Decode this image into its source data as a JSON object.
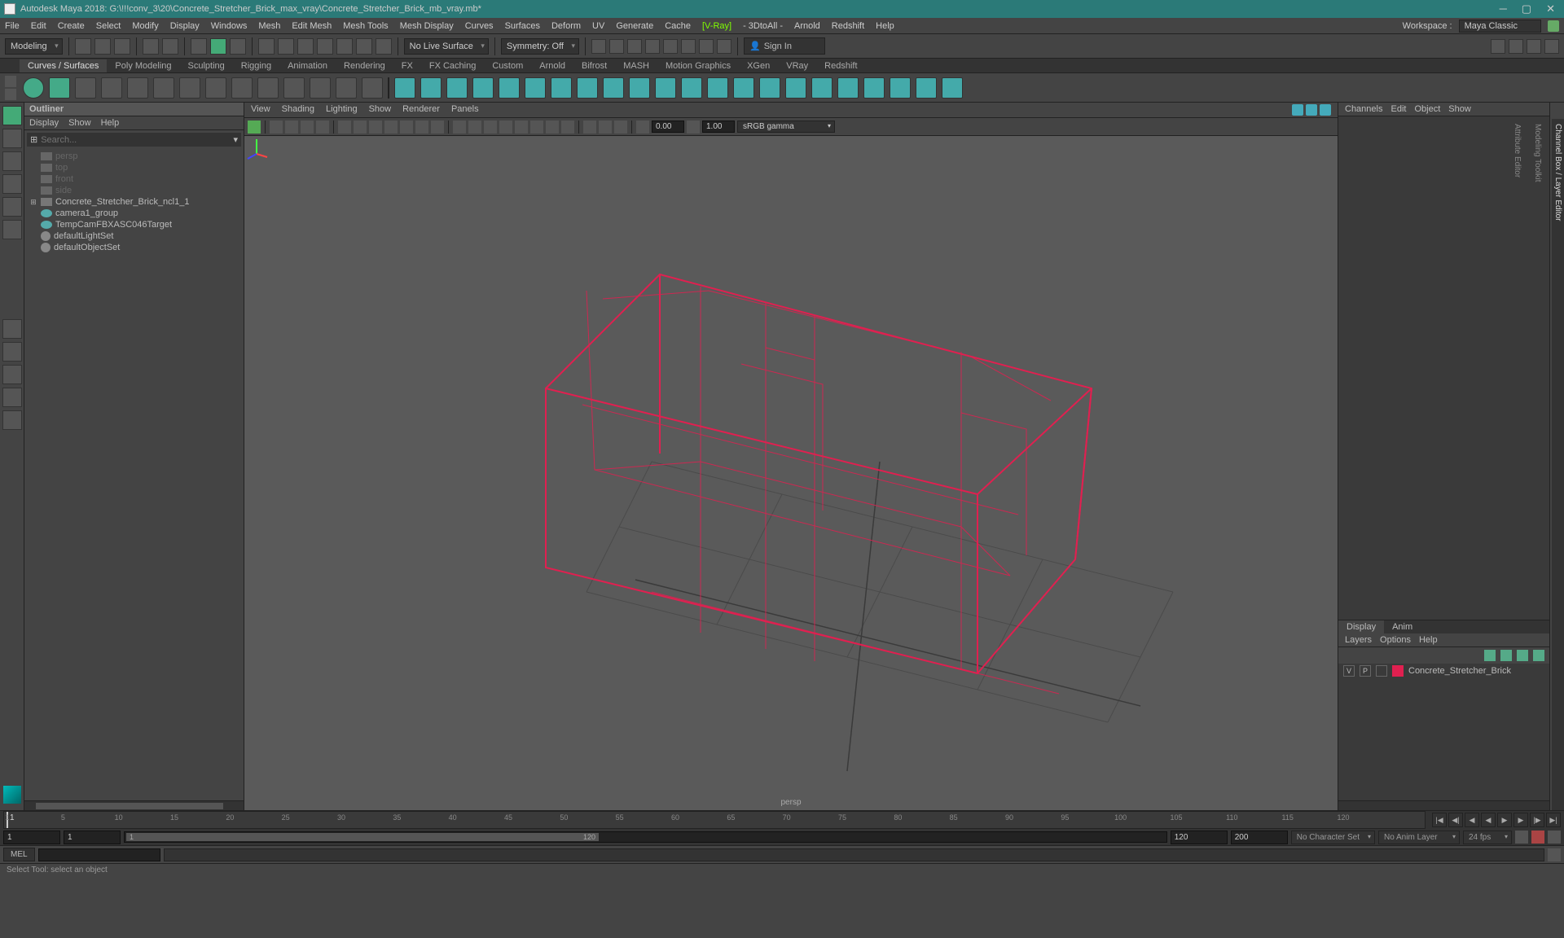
{
  "title": "Autodesk Maya 2018: G:\\!!!conv_3\\20\\Concrete_Stretcher_Brick_max_vray\\Concrete_Stretcher_Brick_mb_vray.mb*",
  "menubar": [
    "File",
    "Edit",
    "Create",
    "Select",
    "Modify",
    "Display",
    "Windows",
    "Mesh",
    "Edit Mesh",
    "Mesh Tools",
    "Mesh Display",
    "Curves",
    "Surfaces",
    "Deform",
    "UV",
    "Generate",
    "Cache"
  ],
  "menubar_vray": "[V-Ray]",
  "menubar2": [
    "- 3DtoAll -",
    "Arnold",
    "Redshift",
    "Help"
  ],
  "workspace_label": "Workspace :",
  "workspace_value": "Maya Classic",
  "modeling_dd": "Modeling",
  "no_live": "No Live Surface",
  "symmetry": "Symmetry: Off",
  "signin": "Sign In",
  "shelf_tabs": [
    "Curves / Surfaces",
    "Poly Modeling",
    "Sculpting",
    "Rigging",
    "Animation",
    "Rendering",
    "FX",
    "FX Caching",
    "Custom",
    "Arnold",
    "Bifrost",
    "MASH",
    "Motion Graphics",
    "XGen",
    "VRay",
    "Redshift"
  ],
  "outliner": {
    "title": "Outliner",
    "menu": [
      "Display",
      "Show",
      "Help"
    ],
    "search_placeholder": "Search...",
    "items": [
      {
        "label": "persp",
        "type": "cam",
        "dim": true
      },
      {
        "label": "top",
        "type": "cam",
        "dim": true
      },
      {
        "label": "front",
        "type": "cam",
        "dim": true
      },
      {
        "label": "side",
        "type": "cam",
        "dim": true
      },
      {
        "label": "Concrete_Stretcher_Brick_ncl1_1",
        "type": "mesh",
        "expand": true
      },
      {
        "label": "camera1_group",
        "type": "grp"
      },
      {
        "label": "TempCamFBXASC046Target",
        "type": "grp"
      },
      {
        "label": "defaultLightSet",
        "type": "set"
      },
      {
        "label": "defaultObjectSet",
        "type": "set"
      }
    ]
  },
  "viewport": {
    "menu": [
      "View",
      "Shading",
      "Lighting",
      "Show",
      "Renderer",
      "Panels"
    ],
    "num1": "0.00",
    "num2": "1.00",
    "gamma": "sRGB gamma",
    "camera": "persp"
  },
  "right_panel": {
    "menu": [
      "Channels",
      "Edit",
      "Object",
      "Show"
    ],
    "tabs": [
      "Display",
      "Anim"
    ],
    "menu2": [
      "Layers",
      "Options",
      "Help"
    ],
    "layer": {
      "v": "V",
      "p": "P",
      "name": "Concrete_Stretcher_Brick"
    }
  },
  "right_tabs": [
    "Channel Box / Layer Editor",
    "Modeling Toolkit",
    "Attribute Editor"
  ],
  "timeline": {
    "ticks": [
      1,
      5,
      10,
      15,
      20,
      25,
      30,
      35,
      40,
      45,
      50,
      55,
      60,
      65,
      70,
      75,
      80,
      85,
      90,
      95,
      100,
      105,
      110,
      115,
      120
    ],
    "start": "1",
    "end": "120",
    "range_start": "1",
    "range_end": "120",
    "range_start2": "1",
    "range_end2": "200",
    "charset": "No Character Set",
    "animlayer": "No Anim Layer",
    "fps": "24 fps"
  },
  "cmd_label": "MEL",
  "status": "Select Tool: select an object"
}
